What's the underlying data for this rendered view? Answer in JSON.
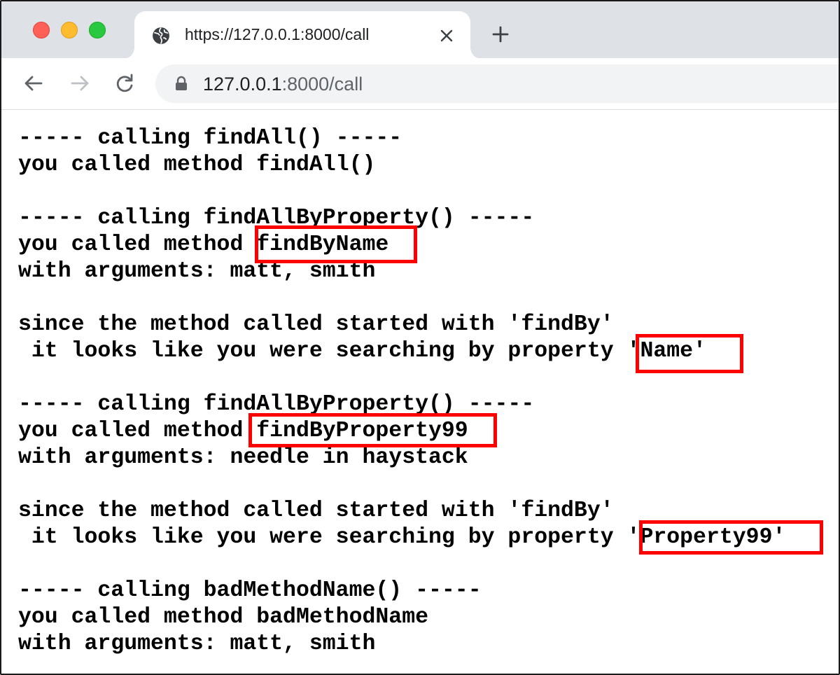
{
  "browser": {
    "tab_title": "https://127.0.0.1:8000/call",
    "url_host": "127.0.0.1",
    "url_rest": ":8000/call"
  },
  "page": {
    "lines": [
      "----- calling findAll() -----",
      "you called method findAll()",
      "",
      "----- calling findAllByProperty() -----",
      "you called method findByName",
      "with arguments: matt, smith",
      "",
      "since the method called started with 'findBy'",
      " it looks like you were searching by property 'Name'",
      "",
      "----- calling findAllByProperty() -----",
      "you called method findByProperty99",
      "with arguments: needle in haystack",
      "",
      "since the method called started with 'findBy'",
      " it looks like you were searching by property 'Property99'",
      "",
      "----- calling badMethodName() -----",
      "you called method badMethodName",
      "with arguments: matt, smith"
    ],
    "highlight_color": "#ff0000"
  },
  "colors": {
    "titlebar": "#dee1e6",
    "omnibox": "#f1f3f4",
    "close": "#fe5f57",
    "minimize": "#febc2e",
    "maximize": "#28c840"
  }
}
